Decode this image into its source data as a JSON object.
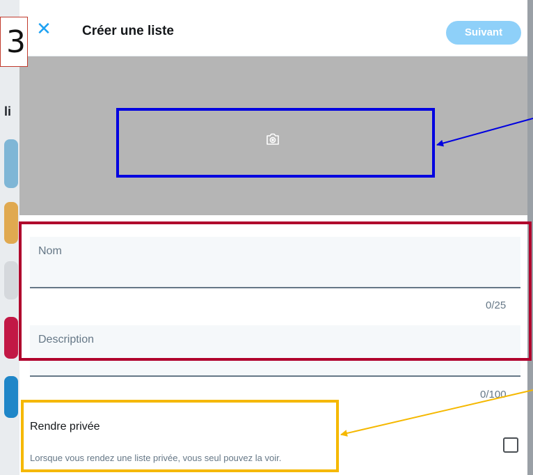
{
  "step_label": "3",
  "background": {
    "fragment": "li"
  },
  "dialog": {
    "title": "Créer une liste",
    "next_label": "Suivant"
  },
  "form": {
    "name": {
      "label": "Nom",
      "counter": "0/25",
      "value": ""
    },
    "description": {
      "label": "Description",
      "counter": "0/100",
      "value": ""
    }
  },
  "privacy": {
    "title": "Rendre privée",
    "description": "Lorsque vous rendez une liste privée, vous seul pouvez la voir.",
    "checked": false
  },
  "icons": {
    "close": "close-icon",
    "camera": "camera-icon"
  },
  "colors": {
    "accent": "#1da1f2",
    "next_button_disabled": "#8ed0f9",
    "banner": "#b5b5b5",
    "annotation_blue": "#0000e0",
    "annotation_red": "#b0002c",
    "annotation_yellow": "#f5b800"
  }
}
